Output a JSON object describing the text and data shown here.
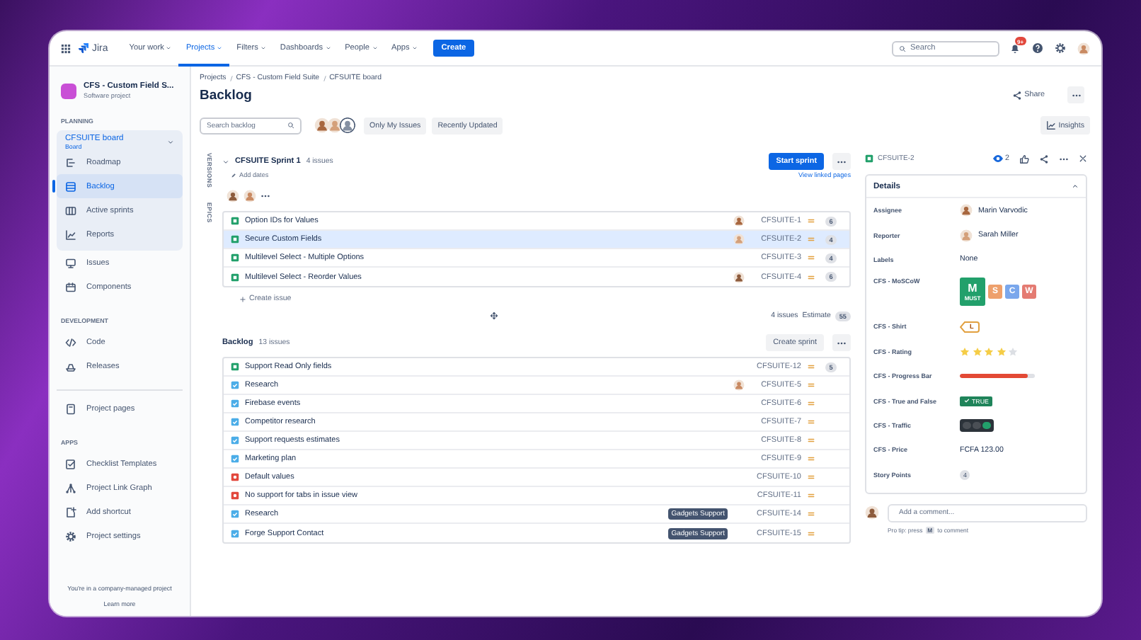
{
  "nav": {
    "logo": "Jira",
    "items": [
      {
        "label": "Your work",
        "selected": false
      },
      {
        "label": "Projects",
        "selected": true
      },
      {
        "label": "Filters",
        "selected": false
      },
      {
        "label": "Dashboards",
        "selected": false
      },
      {
        "label": "People",
        "selected": false
      },
      {
        "label": "Apps",
        "selected": false
      }
    ],
    "create": "Create",
    "search": {
      "placeholder": "Search"
    },
    "notifications": "9+"
  },
  "sidebar": {
    "project": {
      "name": "CFS - Custom Field S...",
      "type": "Software project"
    },
    "sections": [
      {
        "heading": "PLANNING",
        "board": {
          "title": "CFSUITE board",
          "subtitle": "Board",
          "expanded": true,
          "items": [
            {
              "label": "Roadmap",
              "selected": false
            },
            {
              "label": "Backlog",
              "selected": true
            },
            {
              "label": "Active sprints",
              "selected": false
            },
            {
              "label": "Reports",
              "selected": false
            }
          ]
        },
        "items": [
          {
            "label": "Issues",
            "selected": false
          },
          {
            "label": "Components",
            "selected": false
          }
        ]
      },
      {
        "heading": "DEVELOPMENT",
        "items": [
          {
            "label": "Code",
            "selected": false
          },
          {
            "label": "Releases",
            "selected": false
          }
        ]
      },
      {
        "items": [
          {
            "label": "Project pages",
            "selected": false
          }
        ]
      },
      {
        "heading": "APPS",
        "items": [
          {
            "label": "Checklist Templates",
            "selected": false
          },
          {
            "label": "Project Link Graph",
            "selected": false
          },
          {
            "label": "Add shortcut",
            "selected": false
          },
          {
            "label": "Project settings",
            "selected": false
          }
        ]
      }
    ],
    "footer": {
      "text": "You're in a company-managed project",
      "link": "Learn more"
    }
  },
  "header": {
    "breadcrumbs": [
      "Projects",
      "CFS - Custom Field Suite",
      "CFSUITE board"
    ],
    "title": "Backlog",
    "share": "Share",
    "insights": "Insights"
  },
  "toolbar": {
    "search": {
      "placeholder": "Search backlog"
    },
    "filters": [
      {
        "label": "Only My Issues",
        "selected": false
      },
      {
        "label": "Recently Updated",
        "selected": false
      }
    ]
  },
  "side_tabs": [
    "VERSIONS",
    "EPICS"
  ],
  "sprint": {
    "name": "CFSUITE Sprint 1",
    "count": "4 issues",
    "expanded": true,
    "add_dates": "Add dates",
    "start": "Start sprint",
    "linked": "View linked pages",
    "issues": [
      {
        "kind": "story",
        "summary": "Option IDs for Values",
        "assignee": true,
        "key": "CFSUITE-1",
        "points": "6",
        "selected": false
      },
      {
        "kind": "story",
        "summary": "Secure Custom Fields",
        "assignee": true,
        "key": "CFSUITE-2",
        "points": "4",
        "selected": true
      },
      {
        "kind": "story",
        "summary": "Multilevel Select - Multiple Options",
        "assignee": false,
        "key": "CFSUITE-3",
        "points": "4",
        "selected": false
      },
      {
        "kind": "story",
        "summary": "Multilevel Select - Reorder Values",
        "assignee": true,
        "key": "CFSUITE-4",
        "points": "6",
        "selected": false
      }
    ],
    "create": "Create issue",
    "total": "4 issues",
    "estimate_label": "Estimate",
    "estimate": "55"
  },
  "backlog": {
    "name": "Backlog",
    "count": "13 issues",
    "create_sprint": "Create sprint",
    "issues": [
      {
        "kind": "story",
        "summary": "Support Read Only fields",
        "assignee": false,
        "key": "CFSUITE-12",
        "points": "5",
        "selected": false
      },
      {
        "kind": "task",
        "summary": "Research",
        "assignee": true,
        "key": "CFSUITE-5",
        "selected": false
      },
      {
        "kind": "task",
        "summary": "Firebase events",
        "assignee": false,
        "key": "CFSUITE-6",
        "selected": false
      },
      {
        "kind": "task",
        "summary": "Competitor research",
        "assignee": false,
        "key": "CFSUITE-7",
        "selected": false
      },
      {
        "kind": "task",
        "summary": "Support requests estimates",
        "assignee": false,
        "key": "CFSUITE-8",
        "selected": false
      },
      {
        "kind": "task",
        "summary": "Marketing plan",
        "assignee": false,
        "key": "CFSUITE-9",
        "selected": false
      },
      {
        "kind": "bug",
        "summary": "Default values",
        "assignee": false,
        "key": "CFSUITE-10",
        "selected": false
      },
      {
        "kind": "bug",
        "summary": "No support for tabs in issue view",
        "assignee": false,
        "key": "CFSUITE-11",
        "selected": false
      },
      {
        "kind": "task",
        "summary": "Research",
        "assignee": false,
        "label": "Gadgets Support",
        "key": "CFSUITE-14",
        "selected": false
      },
      {
        "kind": "task",
        "summary": "Forge Support Contact",
        "assignee": false,
        "label": "Gadgets Support",
        "key": "CFSUITE-15",
        "selected": false
      }
    ]
  },
  "issue": {
    "kind": "story",
    "key": "CFSUITE-2",
    "watchers": "2",
    "details": {
      "heading": "Details",
      "expanded": true,
      "fields": [
        {
          "kind": "user",
          "label": "Assignee",
          "value": "Marin Varvodic"
        },
        {
          "kind": "user",
          "label": "Reporter",
          "value": "Sarah Miller"
        },
        {
          "kind": "text",
          "label": "Labels",
          "value": "None"
        },
        {
          "kind": "moscow",
          "label": "CFS - MoSCoW",
          "options": [
            {
              "letter": "M",
              "caption": "MUST",
              "selected": true,
              "color": "#22a06b"
            },
            {
              "letter": "S",
              "selected": false,
              "color": "#eea06c"
            },
            {
              "letter": "C",
              "selected": false,
              "color": "#7aa7ec"
            },
            {
              "letter": "W",
              "selected": false,
              "color": "#e47b72"
            }
          ]
        },
        {
          "kind": "shirt",
          "label": "CFS - Shirt",
          "value": "L"
        },
        {
          "kind": "rating",
          "label": "CFS - Rating",
          "stars": 4
        },
        {
          "kind": "progress",
          "label": "CFS - Progress Bar",
          "level": 0.9
        },
        {
          "kind": "boolean",
          "label": "CFS - True and False",
          "value": "TRUE",
          "on": true
        },
        {
          "kind": "traffic",
          "label": "CFS - Traffic",
          "lights": [
            {
              "on": false
            },
            {
              "on": false
            },
            {
              "on": true,
              "color": "#22a06b"
            }
          ]
        },
        {
          "kind": "text",
          "label": "CFS - Price",
          "value": "FCFA 123.00"
        },
        {
          "kind": "badge",
          "label": "Story Points",
          "value": "4"
        }
      ]
    },
    "comment": {
      "placeholder": "Add a comment...",
      "tip_start": "Pro tip: press",
      "tip_key": "M",
      "tip_end": "to comment"
    }
  }
}
